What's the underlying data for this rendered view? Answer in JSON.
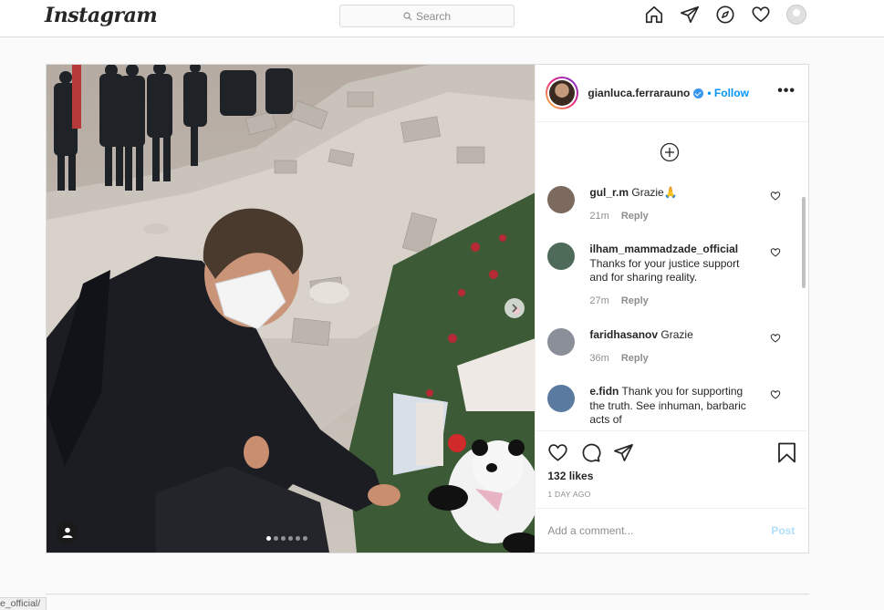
{
  "nav": {
    "logo": "Instagram",
    "search_placeholder": "Search",
    "icons": [
      "home-icon",
      "direct-icon",
      "explore-icon",
      "activity-heart-icon",
      "profile-avatar"
    ]
  },
  "post": {
    "username": "gianluca.ferrarauno",
    "verified": true,
    "follow_label": "• Follow",
    "more_label": "•••",
    "carousel": {
      "slides": 6,
      "active_index": 0
    },
    "comments": [
      {
        "username": "gul_r.m",
        "text": "Grazie🙏",
        "time": "21m",
        "reply": "Reply",
        "avatar_color": "#7b6a5d"
      },
      {
        "username": "ilham_mammadzade_official",
        "text": "Thanks for your justice support and for sharing reality.",
        "time": "27m",
        "reply": "Reply",
        "avatar_color": "#4e6b5a"
      },
      {
        "username": "faridhasanov",
        "text": "Grazie",
        "time": "36m",
        "reply": "Reply",
        "avatar_color": "#8a8f9a"
      },
      {
        "username": "e.fidn",
        "text": "Thank you for supporting the truth. See inhuman, barbaric acts of",
        "time": "",
        "reply": "",
        "avatar_color": "#5a7aa0"
      }
    ],
    "likes": "132 likes",
    "time_ago": "1 DAY AGO",
    "add_comment_placeholder": "Add a comment...",
    "post_button": "Post"
  },
  "status_bar": {
    "url": "e_official/"
  },
  "colors": {
    "accent": "#0095f6",
    "muted": "#8e8e8e",
    "border": "#dbdbdb",
    "post_disabled": "#b2dffc"
  }
}
